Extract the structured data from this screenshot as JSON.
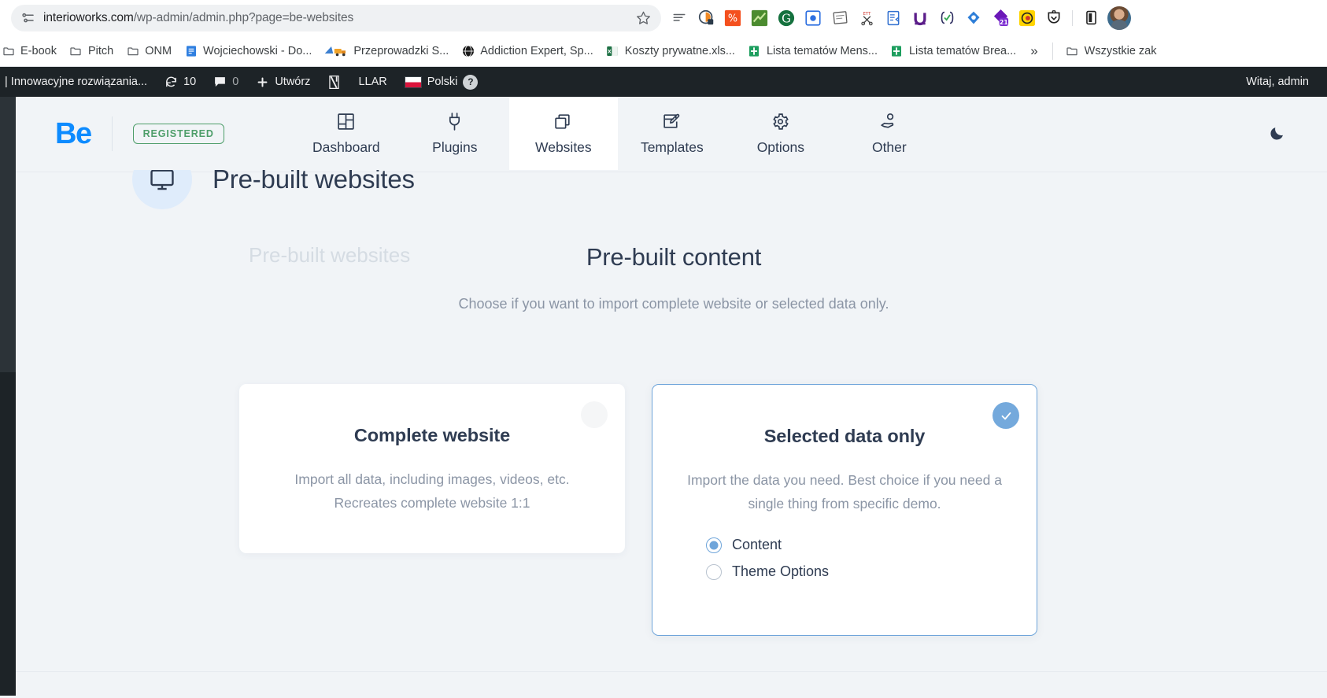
{
  "browser": {
    "url_bold": "interioworks.com",
    "url_rest": "/wp-admin/admin.php?page=be-websites",
    "site_info_icon": "tune-icon",
    "star_icon": "bookmark-star-icon",
    "extensions": [
      {
        "name": "reading-list-icon",
        "label": "Reading list"
      },
      {
        "name": "privacy-badger-icon",
        "label": "Privacy Badger"
      },
      {
        "name": "seo-percent-icon",
        "label": "SEO extension"
      },
      {
        "name": "green-chart-icon",
        "label": "Analytics extension"
      },
      {
        "name": "grammarly-icon",
        "label": "Grammarly"
      },
      {
        "name": "blue-square-icon",
        "label": "Loom"
      },
      {
        "name": "notes-sketch-icon",
        "label": "Notes"
      },
      {
        "name": "ett-scissors-icon",
        "label": "ETT clipper"
      },
      {
        "name": "form-edit-icon",
        "label": "Form filler"
      },
      {
        "name": "purple-u-icon",
        "label": "Ubersuggest"
      },
      {
        "name": "code-check-icon",
        "label": "Code checker"
      },
      {
        "name": "blue-tag-icon",
        "label": "Tag assistant"
      },
      {
        "name": "purple-diamond-21-icon",
        "label": "Extension 21"
      },
      {
        "name": "yellow-record-icon",
        "label": "Screen recorder"
      },
      {
        "name": "pocket-icon",
        "label": "Pocket"
      }
    ],
    "extensions_puzzle_icon": "extensions-puzzle-icon",
    "side_panel_icon": "side-panel-icon",
    "avatar_icon": "profile-avatar",
    "bookmarks": [
      {
        "label": "E-book",
        "icon": "folder-icon"
      },
      {
        "label": "Pitch",
        "icon": "folder-icon"
      },
      {
        "label": "ONM",
        "icon": "folder-icon"
      },
      {
        "label": "Wojciechowski - Do...",
        "icon": "google-docs-icon"
      },
      {
        "label": "Przeprowadzki S...",
        "icon": "moving-truck-icon"
      },
      {
        "label": "Addiction Expert, Sp...",
        "icon": "globe-icon"
      },
      {
        "label": "Koszty prywatne.xls...",
        "icon": "excel-icon"
      },
      {
        "label": "Lista tematów Mens...",
        "icon": "google-sheets-icon"
      },
      {
        "label": "Lista tematów Brea...",
        "icon": "google-sheets-icon"
      }
    ],
    "bookmarks_overflow": "»",
    "all_bookmarks_label": "Wszystkie zak",
    "all_bookmarks_icon": "folder-icon"
  },
  "wp_adminbar": {
    "site_name": "| Innowacyjne rozwiązania...",
    "updates_icon": "updates-icon",
    "updates_count": "10",
    "comments_icon": "comment-bubble-icon",
    "comments_count": "0",
    "new_icon": "plus-icon",
    "new_label": "Utwórz",
    "yoast_icon": "yoast-icon",
    "llar_label": "LLAR",
    "language_flag_icon": "poland-flag-icon",
    "language_label": "Polski",
    "help_icon": "help-question-icon",
    "greeting": "Witaj, admin"
  },
  "be_header": {
    "logo": "Be",
    "license_badge": "REGISTERED",
    "dark_mode_icon": "moon-icon",
    "nav": [
      {
        "label": "Dashboard",
        "icon": "dashboard-grid-icon",
        "active": false
      },
      {
        "label": "Plugins",
        "icon": "plug-icon",
        "active": false
      },
      {
        "label": "Websites",
        "icon": "stacked-windows-icon",
        "active": true
      },
      {
        "label": "Templates",
        "icon": "template-edit-icon",
        "active": false
      },
      {
        "label": "Options",
        "icon": "gear-icon",
        "active": false
      },
      {
        "label": "Other",
        "icon": "hand-user-icon",
        "active": false
      }
    ]
  },
  "page": {
    "title": "Pre-built websites",
    "title_icon": "monitor-icon",
    "step_previous": "Pre-built websites",
    "step_current": "Pre-built content",
    "step_description": "Choose if you want to import complete website or selected data only."
  },
  "cards": {
    "complete": {
      "title": "Complete website",
      "description": "Import all data, including images, videos, etc. Recreates complete website 1:1",
      "marker_icon": "empty-circle-icon",
      "selected": false
    },
    "selected_data": {
      "title": "Selected data only",
      "description": "Import the data you need. Best choice if you need a single thing from specific demo.",
      "marker_icon": "check-circle-icon",
      "selected": true,
      "options": [
        {
          "label": "Content",
          "checked": true
        },
        {
          "label": "Theme Options",
          "checked": false
        }
      ]
    }
  },
  "colors": {
    "accent_blue": "#0d8bff",
    "selection_blue": "#74a9dc",
    "registered_green": "#4e9e6a",
    "page_bg": "#f1f4f7",
    "text_dark": "#2f3c52",
    "text_muted": "#8b95a5"
  }
}
